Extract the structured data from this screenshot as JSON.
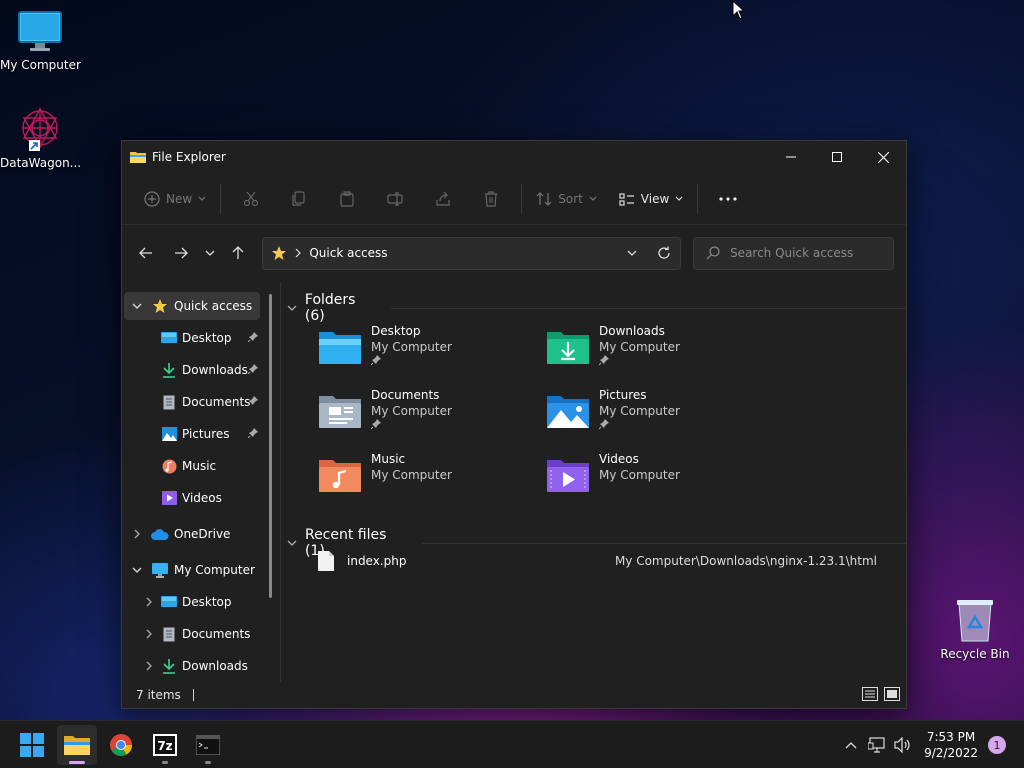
{
  "desktop": {
    "icons": [
      {
        "label": "My Computer"
      },
      {
        "label": "DataWagon..."
      },
      {
        "label": "Recycle Bin"
      }
    ]
  },
  "window": {
    "title": "File Explorer",
    "commands": {
      "new_label": "New",
      "sort_label": "Sort",
      "view_label": "View"
    },
    "address": {
      "crumb": "Quick access",
      "search_placeholder": "Search Quick access"
    },
    "nav": {
      "items": [
        {
          "label": "Quick access"
        },
        {
          "label": "Desktop"
        },
        {
          "label": "Downloads"
        },
        {
          "label": "Documents"
        },
        {
          "label": "Pictures"
        },
        {
          "label": "Music"
        },
        {
          "label": "Videos"
        },
        {
          "label": "OneDrive"
        },
        {
          "label": "My Computer"
        },
        {
          "label": "Desktop"
        },
        {
          "label": "Documents"
        },
        {
          "label": "Downloads"
        }
      ]
    },
    "folders": {
      "header": "Folders (6)",
      "items": [
        {
          "name": "Desktop",
          "location": "My Computer"
        },
        {
          "name": "Downloads",
          "location": "My Computer"
        },
        {
          "name": "Documents",
          "location": "My Computer"
        },
        {
          "name": "Pictures",
          "location": "My Computer"
        },
        {
          "name": "Music",
          "location": "My Computer"
        },
        {
          "name": "Videos",
          "location": "My Computer"
        }
      ]
    },
    "recent": {
      "header": "Recent files (1)",
      "items": [
        {
          "name": "index.php",
          "path": "My Computer\\Downloads\\nginx-1.23.1\\html"
        }
      ]
    },
    "status": {
      "count": "7 items"
    }
  },
  "taskbar": {
    "time": "7:53 PM",
    "date": "9/2/2022",
    "notifications": "1"
  },
  "colors": {
    "accent": "#d6a3ff",
    "window_bg": "#202020",
    "selected_bg": "#383838"
  }
}
